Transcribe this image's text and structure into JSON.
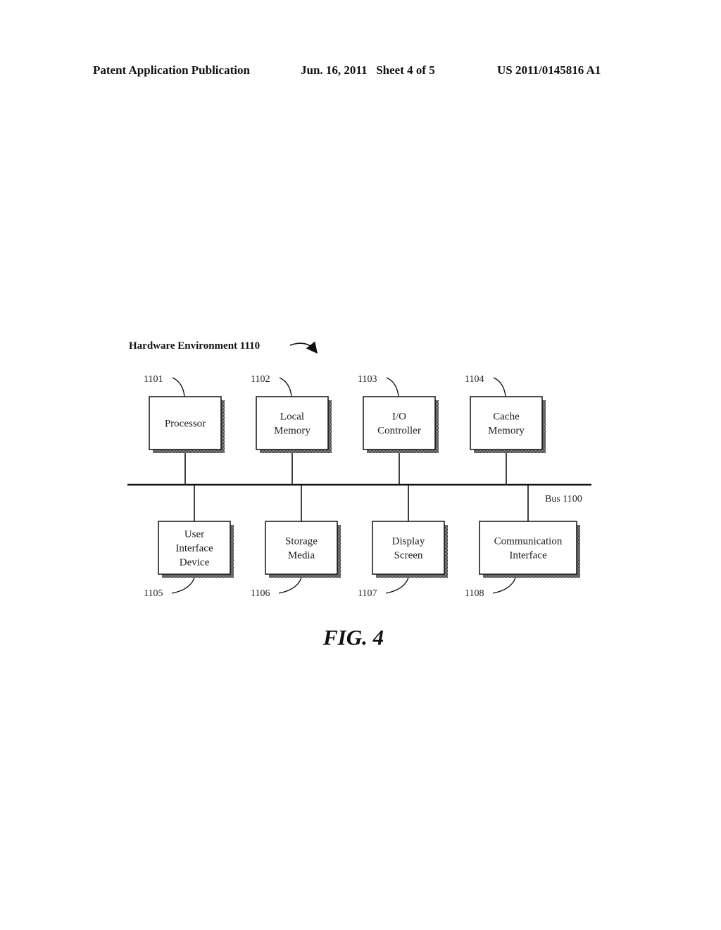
{
  "header": {
    "publication": "Patent Application Publication",
    "date_sheet": "Jun. 16, 2011   Sheet 4 of 5",
    "number": "US 2011/0145816 A1"
  },
  "diagram": {
    "title": "Hardware Environment 1110",
    "bus_label": "Bus 1100",
    "figure_label": "FIG. 4",
    "top_components": [
      {
        "ref": "1101",
        "lines": [
          "Processor"
        ]
      },
      {
        "ref": "1102",
        "lines": [
          "Local",
          "Memory"
        ]
      },
      {
        "ref": "1103",
        "lines": [
          "I/O",
          "Controller"
        ]
      },
      {
        "ref": "1104",
        "lines": [
          "Cache",
          "Memory"
        ]
      }
    ],
    "bottom_components": [
      {
        "ref": "1105",
        "lines": [
          "User",
          "Interface",
          "Device"
        ]
      },
      {
        "ref": "1106",
        "lines": [
          "Storage",
          "Media"
        ]
      },
      {
        "ref": "1107",
        "lines": [
          "Display",
          "Screen"
        ]
      },
      {
        "ref": "1108",
        "lines": [
          "Communication",
          "Interface"
        ]
      }
    ]
  }
}
